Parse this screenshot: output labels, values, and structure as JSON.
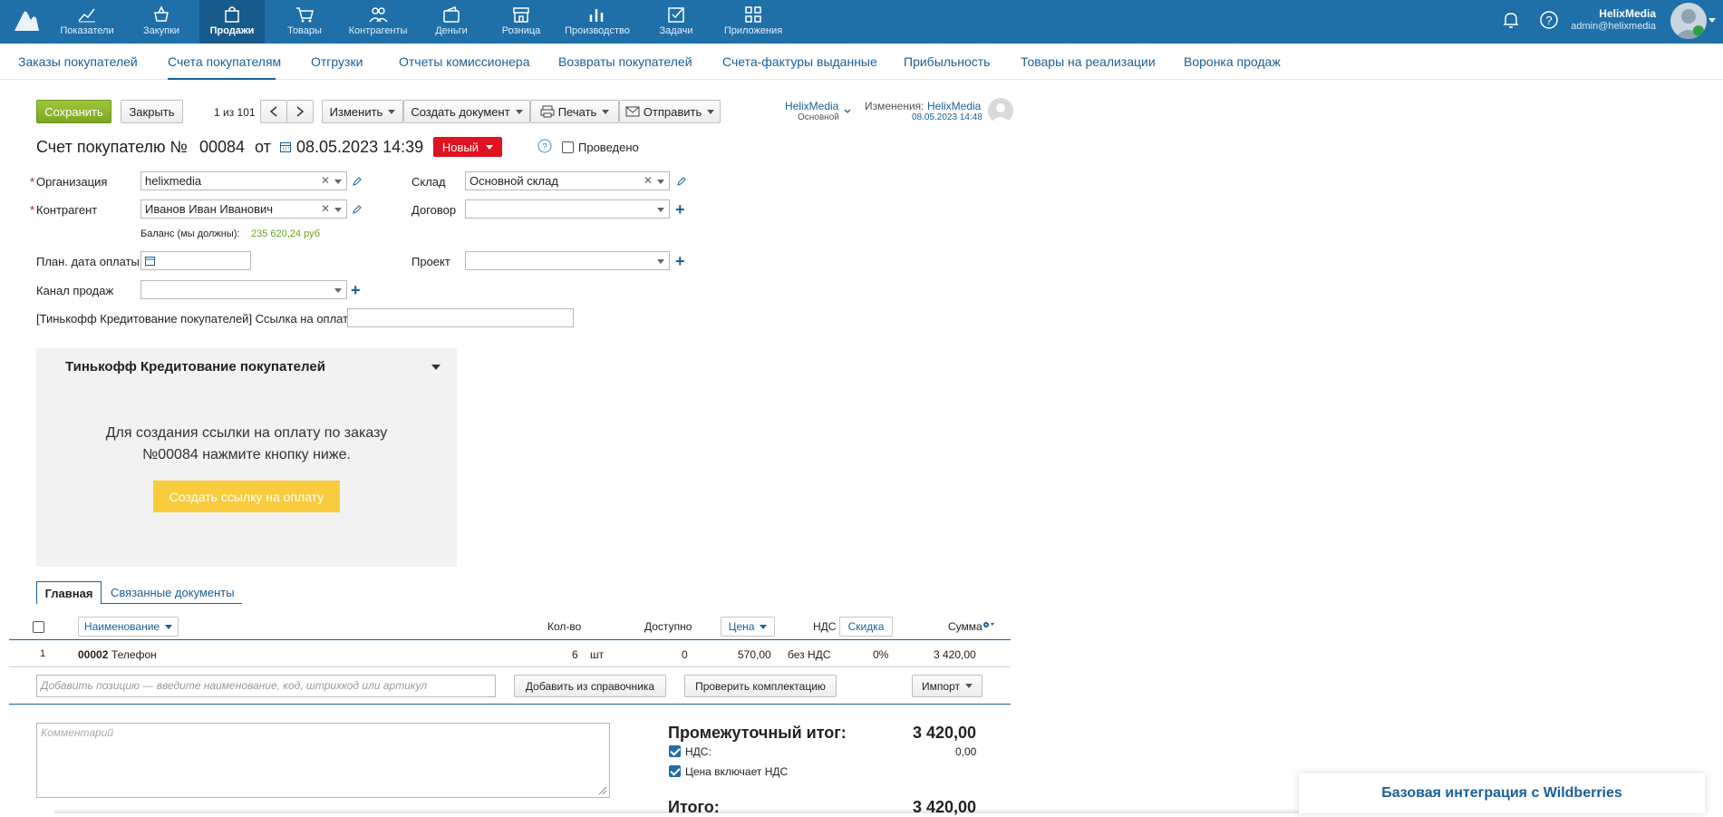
{
  "topnav": {
    "items": [
      {
        "label": "Показатели",
        "icon": "chart-line-icon"
      },
      {
        "label": "Закупки",
        "icon": "basket-icon"
      },
      {
        "label": "Продажи",
        "icon": "bag-icon",
        "active": true
      },
      {
        "label": "Товары",
        "icon": "cart-icon"
      },
      {
        "label": "Контрагенты",
        "icon": "users-icon"
      },
      {
        "label": "Деньги",
        "icon": "wallet-icon"
      },
      {
        "label": "Розница",
        "icon": "store-icon"
      },
      {
        "label": "Производство",
        "icon": "bar-chart-icon"
      },
      {
        "label": "Задачи",
        "icon": "checkbox-icon"
      },
      {
        "label": "Приложения",
        "icon": "apps-icon"
      }
    ],
    "user_name": "HelixMedia",
    "user_email": "admin@helixmedia"
  },
  "subnav": {
    "items": [
      "Заказы покупателей",
      "Счета покупателям",
      "Отгрузки",
      "Отчеты комиссионера",
      "Возвраты покупателей",
      "Счета-фактуры выданные",
      "Прибыльность",
      "Товары на реализации",
      "Воронка продаж"
    ]
  },
  "toolbar": {
    "save": "Сохранить",
    "close": "Закрыть",
    "pager": "1 из 101",
    "edit": "Изменить",
    "create_doc": "Создать документ",
    "print": "Печать",
    "send": "Отправить",
    "org_name": "HelixMedia",
    "org_sub": "Основной",
    "changes_label": "Изменения:",
    "changes_user": "HelixMedia",
    "changes_date": "08.05.2023 14:48"
  },
  "doc": {
    "title_prefix": "Счет покупателю №",
    "number": "00084",
    "from": "от",
    "date": "08.05.2023 14:39",
    "status": "Новый",
    "conducted_label": "Проведено",
    "status_color": "#e0121f"
  },
  "form": {
    "org_label": "Организация",
    "org_value": "helixmedia",
    "contractor_label": "Контрагент",
    "contractor_value": "Иванов Иван Иванович",
    "balance_label": "Баланс (мы должны):",
    "balance_value": "235 620,24 руб",
    "plan_date_label": "План. дата оплаты",
    "channel_label": "Канал продаж",
    "link_label": "[Тинькофф Кредитование покупателей] Ссылка на оплату",
    "warehouse_label": "Склад",
    "warehouse_value": "Основной склад",
    "contract_label": "Договор",
    "project_label": "Проект"
  },
  "panel": {
    "title": "Тинькофф Кредитование покупателей",
    "text_line1": "Для создания ссылки на оплату по заказу",
    "text_line2": "№00084 нажмите кнопку ниже.",
    "button": "Создать ссылку на оплату"
  },
  "tabs": {
    "main": "Главная",
    "related": "Связанные документы"
  },
  "table": {
    "headers": {
      "name": "Наименование",
      "qty": "Кол-во",
      "available": "Доступно",
      "price": "Цена",
      "vat": "НДС",
      "discount": "Скидка",
      "sum": "Сумма"
    },
    "rows": [
      {
        "num": "1",
        "code": "00002",
        "name": "Телефон",
        "qty": "6",
        "unit": "шт",
        "available": "0",
        "price": "570,00",
        "vat": "без НДС",
        "discount": "0%",
        "sum": "3 420,00"
      }
    ],
    "add_placeholder": "Добавить позицию — введите наименование, код, штрихкод или артикул",
    "add_from_ref": "Добавить из справочника",
    "check_set": "Проверить комплектацию",
    "import": "Импорт"
  },
  "footer": {
    "comment_placeholder": "Комментарий",
    "subtotal_label": "Промежуточный итог:",
    "subtotal_value": "3 420,00",
    "vat_label": "НДС:",
    "vat_value": "0,00",
    "price_incl_vat": "Цена включает НДС",
    "total_label": "Итого:",
    "total_value": "3 420,00"
  },
  "banner": "Базовая интеграция с Wildberries"
}
